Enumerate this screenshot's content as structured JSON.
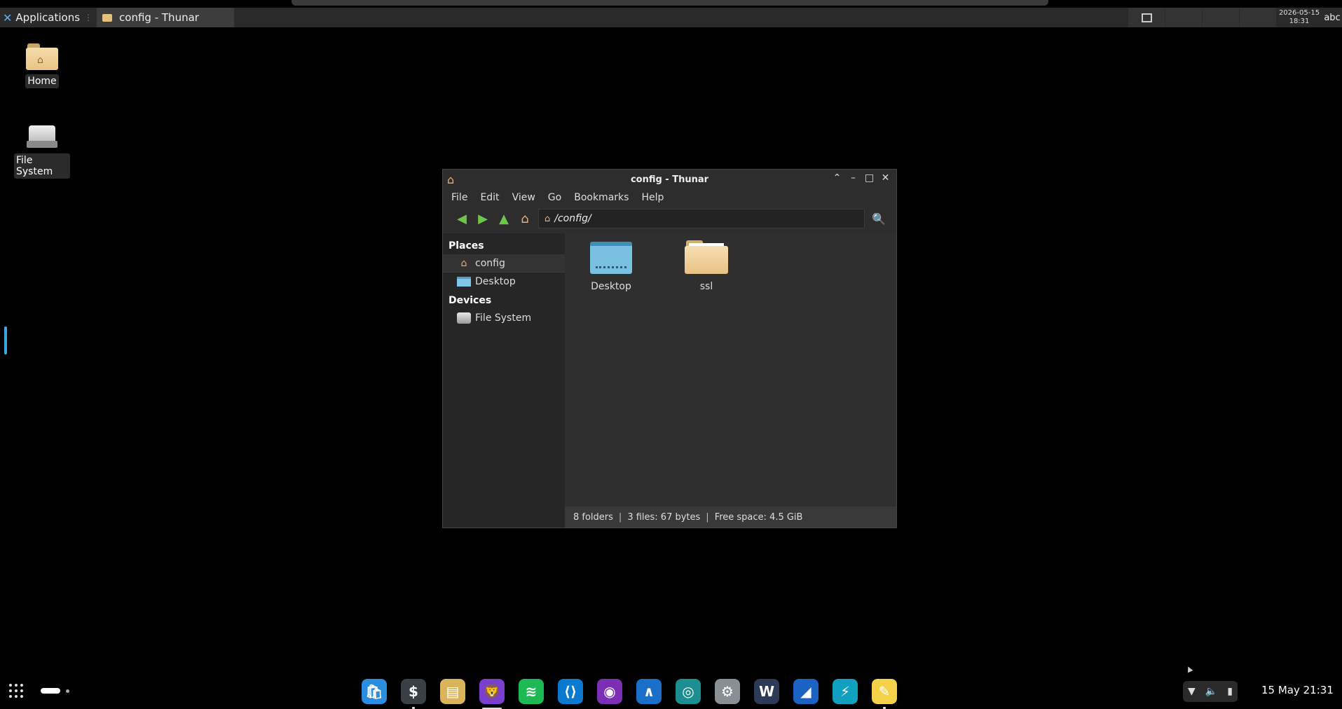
{
  "top_panel": {
    "applications_label": "Applications",
    "task_title": "config - Thunar",
    "clock_date": "2026-05-15",
    "clock_time": "18:31",
    "input_method": "abc"
  },
  "desktop": {
    "icons": [
      {
        "label": "Home",
        "icon": "home-folder-icon"
      },
      {
        "label": "File System",
        "icon": "drive-icon"
      }
    ]
  },
  "window": {
    "title": "config - Thunar",
    "menu": [
      "File",
      "Edit",
      "View",
      "Go",
      "Bookmarks",
      "Help"
    ],
    "location": "/config/",
    "sidebar": {
      "places_heading": "Places",
      "places": [
        "config",
        "Desktop"
      ],
      "devices_heading": "Devices",
      "devices": [
        "File System"
      ]
    },
    "files": [
      {
        "name": "Desktop",
        "icon": "desktop-folder-icon"
      },
      {
        "name": "ssl",
        "icon": "folder-icon"
      }
    ],
    "status": {
      "folders": "8 folders",
      "files": "3 files: 67 bytes",
      "free": "Free space: 4.5 GiB"
    }
  },
  "dock": {
    "apps": [
      {
        "name": "store",
        "color": "#2a8de0"
      },
      {
        "name": "terminal",
        "color": "#3a3f46"
      },
      {
        "name": "files",
        "color": "#d9b45a"
      },
      {
        "name": "brave",
        "color": "#7b3fd0"
      },
      {
        "name": "spotify",
        "color": "#1db954"
      },
      {
        "name": "vscode",
        "color": "#0a7ad0"
      },
      {
        "name": "tor",
        "color": "#7a2fb5"
      },
      {
        "name": "arduino",
        "color": "#1a6fc8"
      },
      {
        "name": "capture",
        "color": "#1b8f8f"
      },
      {
        "name": "settings",
        "color": "#8a8f96"
      },
      {
        "name": "wps",
        "color": "#2c3a55"
      },
      {
        "name": "wireshark",
        "color": "#1b62c4"
      },
      {
        "name": "bolt",
        "color": "#12a0c0"
      },
      {
        "name": "editor",
        "color": "#f3d14a"
      }
    ],
    "clock": "15 May  21:31"
  }
}
